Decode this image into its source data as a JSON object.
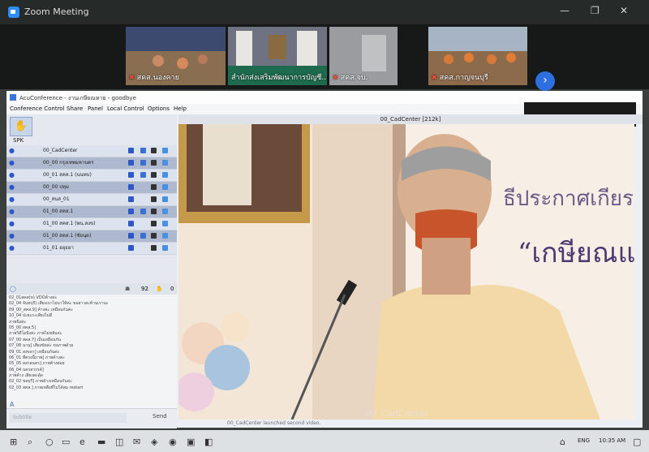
{
  "zoom": {
    "title": "Zoom Meeting",
    "participants": [
      {
        "name": "สคส.นองคาย"
      },
      {
        "name": "สำนักส่งเสริมพัฒนาการบัญชี..."
      },
      {
        "name": "สคส.จบ."
      },
      {
        "name": "สคส.กาญจนบุรี"
      }
    ],
    "next_icon": "chevron-right-icon",
    "minimize": "—",
    "maximize": "❐",
    "close": "✕"
  },
  "acu": {
    "title": "AcuConference - งานเกษียณหาย - goodbye",
    "menu": [
      "Conference Control",
      "Share",
      "Panel",
      "Local Control",
      "Options",
      "Help"
    ],
    "video_header": "00_CadCenter [212k]",
    "spk_label": "SPK",
    "participants": [
      {
        "name": "00_CadCenter",
        "style": "norm"
      },
      {
        "name": "00_00 กรุงเทพมหานคร",
        "style": "alt"
      },
      {
        "name": "00_01 สคส.1 (นนทบ)",
        "style": "norm"
      },
      {
        "name": "00_00 ปทุม",
        "style": "alt"
      },
      {
        "name": "00_สนส_01",
        "style": "norm"
      },
      {
        "name": "01_00 สคส.1",
        "style": "alt"
      },
      {
        "name": "01_00 สคส.1 (พน.สงข)",
        "style": "norm"
      },
      {
        "name": "01_00 สคส.1 (ชัยนุด)",
        "style": "alt"
      },
      {
        "name": "01_01 อยุธยา",
        "style": "norm"
      }
    ],
    "count_left": "92",
    "count_right": "0",
    "chat_lines": [
      "02_01สคส(ห) VDOค้างค่ะ",
      "02_04 จันทบุรี) เสียงเบาไม่มาให้ค่ะ ขอสาวสะท้านเรานะ",
      "09_00_สคส.9] ค้างค่ะ เหมือนกันค่ะ",
      "10_04 ปะยะกะเสียงไม่ดี",
      "ภาพนิ่งค่ะ",
      "05_00 สคส.5]",
      "ภาพวิดีโอนิ่งค่ะ ภาพไม่ขยับค่ะ",
      "07_00 สคส.7] เป็นเหมือนกัน",
      "07_08 นาน] เสียงขัดค่ะ ขอภาพด้วย",
      "09_01 สงขลา] เหมือนกันค่ะ",
      "06_01 ที่ตรงนี้ภาพ] ภาพค้างค่ะ",
      "05_05 สงกลนคร] ภาพค้างต่อย",
      "06_04 นครสวรรค์]",
      "ภาพค้าง เสียงสะดุ้ด",
      "02_02 ชลบุรี] ภาพค้างเหมือนกันค่ะ",
      "02_03 สคส.] ภาพเหลือที่ไม่ได้สม restart"
    ],
    "chat_placeholder": "Subtitle",
    "send_label": "Send",
    "status": "00_CadCenter launched second video.",
    "watermark": "00_CadCenter",
    "banner_text_1": "ธีประกาศเกียรติ",
    "banner_text_2": "“เกษียณแห"
  },
  "taskbar": {
    "lang": "ENG",
    "clock": "10:35 AM"
  }
}
